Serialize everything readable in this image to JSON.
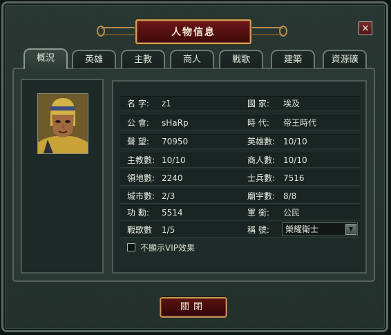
{
  "title": "人物信息",
  "close_label": "×",
  "tabs": [
    "概況",
    "英雄",
    "主教",
    "商人",
    "戰歌",
    "建築",
    "資源礦"
  ],
  "fields": {
    "name_label": "名 字:",
    "name": "z1",
    "country_label": "國 家:",
    "country": "埃及",
    "guild_label": "公 會:",
    "guild": "sHaRp",
    "era_label": "時 代:",
    "era": "帝王時代",
    "reputation_label": "聲 望:",
    "reputation": "70950",
    "heroes_label": "英雄數:",
    "heroes": "10/10",
    "bishops_label": "主教數:",
    "bishops": "10/10",
    "merchants_label": "商人數:",
    "merchants": "10/10",
    "territory_label": "領地數:",
    "territory": "2240",
    "soldiers_label": "士兵數:",
    "soldiers": "7516",
    "cities_label": "城市數:",
    "cities": "2/3",
    "temples_label": "廟宇數:",
    "temples": "8/8",
    "merit_label": "功 勳:",
    "merit": "5514",
    "rank_label": "軍 銜:",
    "rank": "公民",
    "warsongs_label": "戰歌數",
    "warsongs": "1/5",
    "nickname_label": "稱 號:",
    "nickname": "榮耀衛士"
  },
  "vip_label": "不顯示VIP效果",
  "close_button": "關閉"
}
